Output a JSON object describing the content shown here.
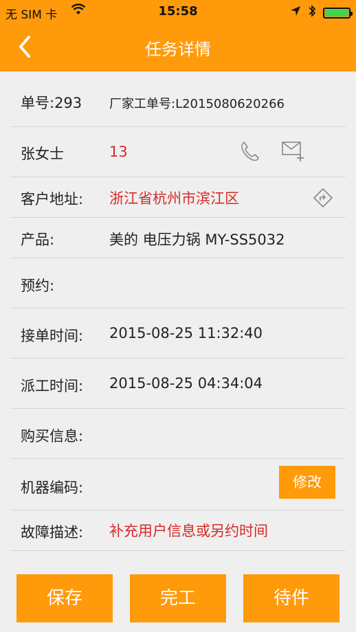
{
  "status_bar": {
    "carrier": "无 SIM 卡",
    "time": "15:58",
    "battery_level": 1.0,
    "icons": [
      "wifi-icon",
      "location-arrow-icon",
      "bluetooth-icon",
      "battery-icon"
    ]
  },
  "nav": {
    "title": "任务详情",
    "back_icon": "chevron-left-icon"
  },
  "fields": {
    "order_no": {
      "label": "单号:293",
      "factory_label": "厂家工单号:L2015080620266"
    },
    "customer": {
      "name": "张女士",
      "phone_visible": "13"
    },
    "address": {
      "label": "客户地址:",
      "value": "浙江省杭州市滨江区"
    },
    "product": {
      "label": "产品:",
      "value": "美的 电压力锅 MY-SS5032"
    },
    "appointment": {
      "label": "预约:"
    },
    "accept_time": {
      "label": "接单时间:",
      "value": "2015-08-25 11:32:40"
    },
    "dispatch_time": {
      "label": "派工时间:",
      "value": "2015-08-25 04:34:04"
    },
    "purchase_info": {
      "label": "购买信息:"
    },
    "machine_code": {
      "label": "机器编码:",
      "edit_button": "修改"
    },
    "fault": {
      "label": "故障描述:",
      "value": "补充用户信息或另约时间"
    }
  },
  "actions": {
    "save": "保存",
    "complete": "完工",
    "pending": "待件"
  },
  "colors": {
    "accent": "#ff9a0a",
    "highlight_text": "#d82828",
    "background": "#efefef"
  }
}
